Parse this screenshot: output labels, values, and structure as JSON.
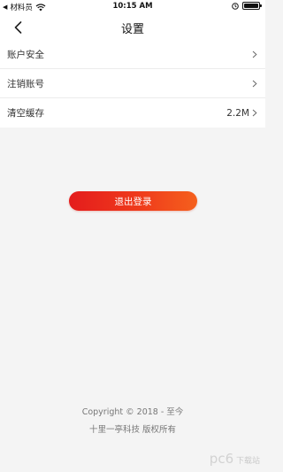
{
  "status_bar": {
    "back_to_app": "材料员",
    "time": "10:15 AM"
  },
  "nav": {
    "title": "设置"
  },
  "settings": [
    {
      "label": "账户安全",
      "value": ""
    },
    {
      "label": "注销账号",
      "value": ""
    },
    {
      "label": "清空缓存",
      "value": "2.2M"
    }
  ],
  "logout_label": "退出登录",
  "footer": {
    "copyright": "Copyright © 2018 - 至今",
    "company": "十里一亭科技 版权所有"
  },
  "watermark": {
    "main": "pc6",
    "sub": "下载站"
  },
  "colors": {
    "accent_start": "#e41c1c",
    "accent_end": "#f5601d",
    "background": "#f4f4f4"
  }
}
